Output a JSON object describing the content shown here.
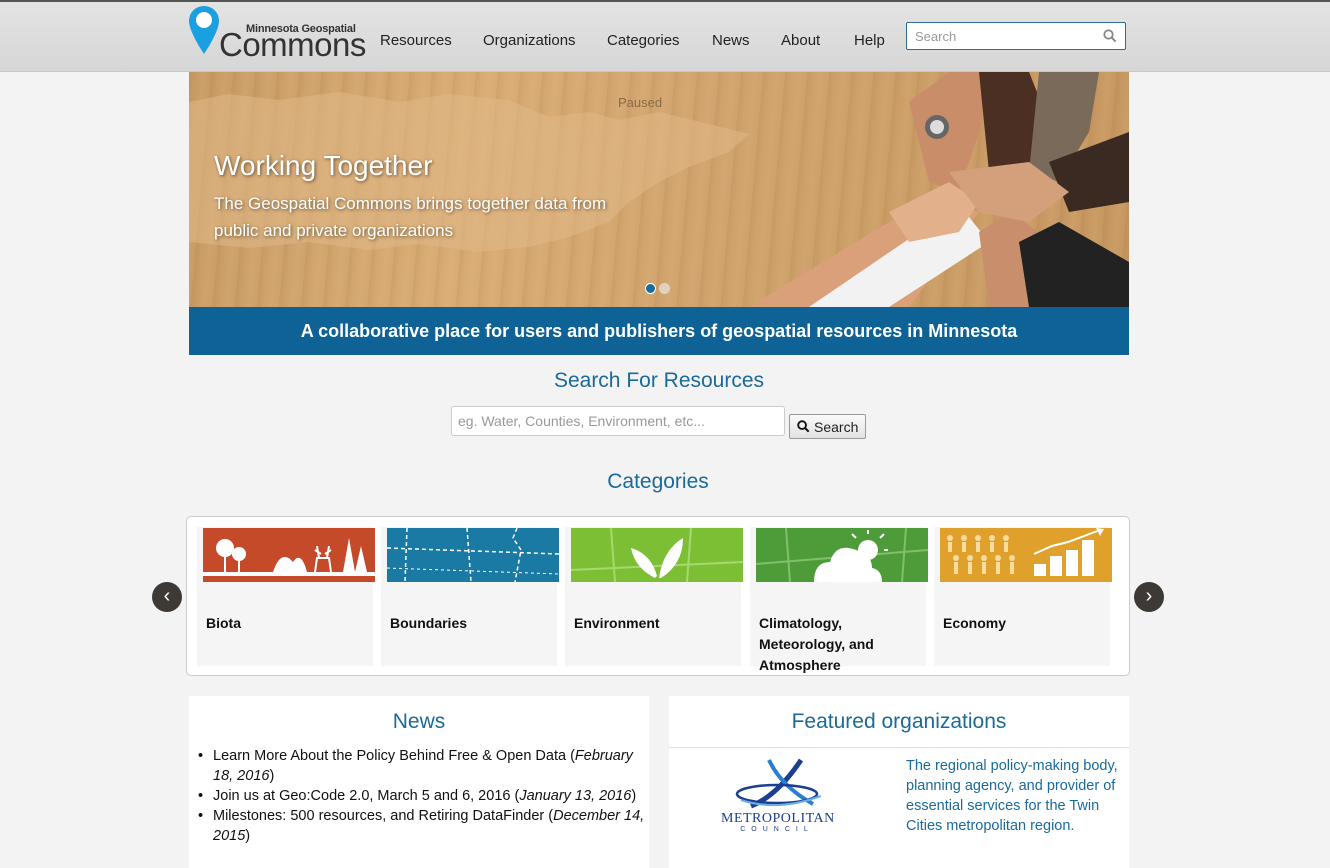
{
  "header": {
    "logo_small": "Minnesota Geospatial",
    "logo_big": "Commons",
    "nav": [
      "Resources",
      "Organizations",
      "Categories",
      "News",
      "About",
      "Help"
    ],
    "search_placeholder": "Search"
  },
  "hero": {
    "status": "Paused",
    "title": "Working Together",
    "subtitle": "The Geospatial Commons brings together data from public and private organizations",
    "slide_count": 2,
    "active_slide": 1
  },
  "tagline": "A collaborative place for users and publishers of geospatial resources in Minnesota",
  "resource_search": {
    "title": "Search For Resources",
    "placeholder": "eg. Water, Counties, Environment, etc...",
    "button_label": "Search"
  },
  "categories": {
    "title": "Categories",
    "prev": "‹",
    "next": "›",
    "items": [
      {
        "label": "Biota",
        "color": "#c44a2a"
      },
      {
        "label": "Boundaries",
        "color": "#1a7aa3"
      },
      {
        "label": "Environment",
        "color": "#7cbf35"
      },
      {
        "label": "Climatology, Meteorology, and Atmosphere",
        "color": "#4e9c39"
      },
      {
        "label": "Economy",
        "color": "#e0a12c"
      }
    ]
  },
  "news": {
    "title": "News",
    "items": [
      {
        "text": "Learn More About the Policy Behind Free & Open Data",
        "date": "February 18, 2016"
      },
      {
        "text": "Join us at Geo:Code 2.0, March 5 and 6, 2016",
        "date": "January 13, 2016"
      },
      {
        "text": "Milestones: 500 resources, and Retiring DataFinder",
        "date": "December 14, 2015"
      }
    ]
  },
  "featured": {
    "title": "Featured organizations",
    "org_name": "METROPOLITAN",
    "org_sub": "COUNCIL",
    "description": "The regional policy-making body, planning agency, and provider of essential services for the Twin Cities metropolitan region."
  }
}
